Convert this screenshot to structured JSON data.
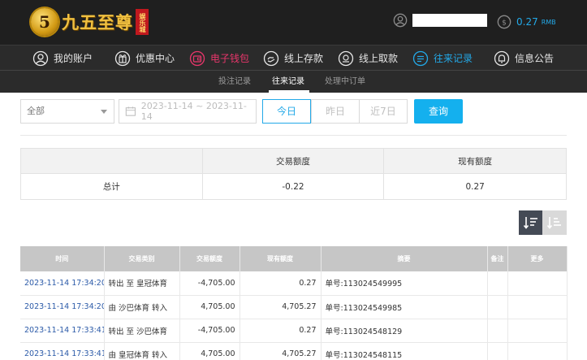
{
  "header": {
    "logo_mark": "5",
    "logo_text": "九五至尊",
    "logo_seal": "娱乐城",
    "balance": "0.27",
    "balance_unit": "RMB",
    "icons": [
      "user-icon",
      "coin-icon"
    ]
  },
  "nav": {
    "items": [
      {
        "label": "我的账户",
        "icon": "user-circle-icon"
      },
      {
        "label": "优惠中心",
        "icon": "gift-icon"
      },
      {
        "label": "电子钱包",
        "icon": "wallet-icon"
      },
      {
        "label": "线上存款",
        "icon": "deposit-icon"
      },
      {
        "label": "线上取款",
        "icon": "withdraw-icon"
      },
      {
        "label": "往来记录",
        "icon": "records-icon"
      },
      {
        "label": "信息公告",
        "icon": "bell-icon"
      }
    ],
    "wallet_color": "#e8366b",
    "active_color": "#23a9e8"
  },
  "subnav": {
    "items": [
      "投注记录",
      "往来记录",
      "处理中订单"
    ]
  },
  "filters": {
    "type_select": "全部",
    "date_range": "2023-11-14 ~ 2023-11-14",
    "quick": [
      "今日",
      "昨日",
      "近7日"
    ],
    "query_label": "查询"
  },
  "summary": {
    "headers": [
      "",
      "交易额度",
      "现有额度"
    ],
    "row": [
      "总计",
      "-0.22",
      "0.27"
    ]
  },
  "records": {
    "headers": [
      "时间",
      "交易类别",
      "交易额度",
      "现有额度",
      "摘要",
      "备注",
      "更多"
    ],
    "rows": [
      [
        "2023-11-14 17:34:20",
        "转出 至 皇冠体育",
        "-4,705.00",
        "0.27",
        "单号:113024549995",
        "",
        ""
      ],
      [
        "2023-11-14 17:34:20",
        "由 沙巴体育 转入",
        "4,705.00",
        "4,705.27",
        "单号:113024549985",
        "",
        ""
      ],
      [
        "2023-11-14 17:33:41",
        "转出 至 沙巴体育",
        "-4,705.00",
        "0.27",
        "单号:113024548129",
        "",
        ""
      ],
      [
        "2023-11-14 17:33:41",
        "由 皇冠体育 转入",
        "4,705.00",
        "4,705.27",
        "单号:113024548115",
        "",
        ""
      ]
    ]
  }
}
